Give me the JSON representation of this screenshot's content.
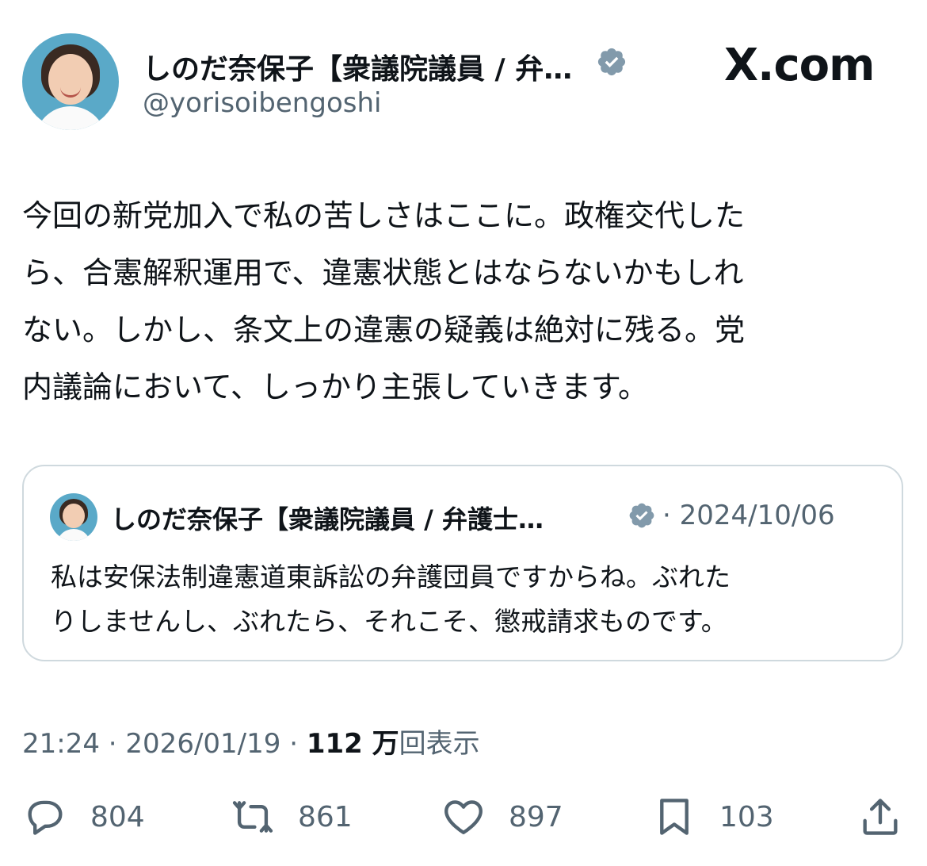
{
  "site_label": "X.com",
  "tweet": {
    "author_name": "しのだ奈保子【衆議院議員 / 弁…",
    "handle": "@yorisoibengoshi",
    "text": "今回の新党加入で私の苦しさはここに。政権交代した\nら、合憲解釈運用で、違憲状態とはならないかもしれ\nない。しかし、条文上の違憲の疑義は絶対に残る。党\n内議論において、しっかり主張していきます。",
    "time": "21:24",
    "date": "2026/01/19",
    "views_count": "112 万",
    "views_label": "回表示"
  },
  "quote": {
    "author_name": "しのだ奈保子【衆議院議員 / 弁護士…",
    "date": "2024/10/06",
    "text": "私は安保法制違憲道東訴訟の弁護団員ですからね。ぶれた\nりしませんし、ぶれたら、それこそ、懲戒請求ものです。"
  },
  "actions": {
    "replies": "804",
    "reposts": "861",
    "likes": "897",
    "bookmarks": "103"
  },
  "icons": {
    "verified": "verified-badge-icon",
    "reply": "reply-icon",
    "repost": "repost-icon",
    "like": "heart-icon",
    "bookmark": "bookmark-icon",
    "share": "share-icon"
  },
  "colors": {
    "text": "#0f1419",
    "secondary": "#536471",
    "verified_badge": "#829aab",
    "border": "#cfd9de"
  }
}
